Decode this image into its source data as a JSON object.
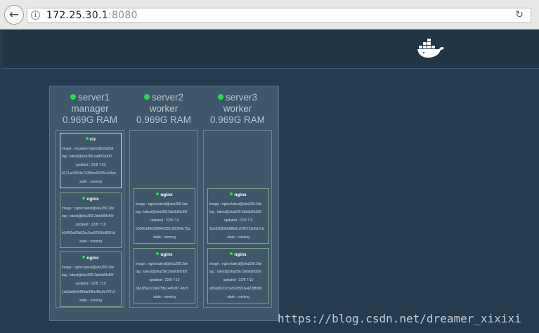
{
  "browser": {
    "url_host": "172.25.30.1",
    "url_port": ":8080"
  },
  "nodes": [
    {
      "name": "server1",
      "role": "manager",
      "ram": "0.969G RAM",
      "tasks": [
        {
          "name": "viz",
          "image": "image : visualizer:latest@sha256",
          "tag": "tag : latest@sha256:ea803c00f7",
          "updated": "updated : 22/8 7:23",
          "id": "8271ac2554e7535bed2035c1c9ee",
          "state": "state : running"
        },
        {
          "name": "nginx",
          "image": "image : nginx:latest@sha256:2de",
          "tag": "tag : latest@sha256:2de9d5fc65f",
          "updated": "updated : 22/8 7:10",
          "id": "b346f9e82b02cc6ce82366d6091d",
          "state": "state : running"
        },
        {
          "name": "nginx",
          "image": "image : nginx:latest@sha256:2de",
          "tag": "tag : latest@sha256:2de9d5fc65f",
          "updated": "updated : 22/8 7:10",
          "id": "1dd3ab0e548fda496e45c9e797c3",
          "state": "state : running"
        }
      ]
    },
    {
      "name": "server2",
      "role": "worker",
      "ram": "0.969G RAM",
      "tasks": [
        {
          "name": "nginx",
          "image": "image : nginx:latest@sha256:2de",
          "tag": "tag : latest@sha256:2de9d5fc65f",
          "updated": "updated : 22/8 7:9",
          "id": "e3506a450299642251092254c75a",
          "state": "state : running"
        },
        {
          "name": "nginx",
          "image": "image : nginx:latest@sha256:2de",
          "tag": "tag : latest@sha256:2de9d5fc65f",
          "updated": "updated : 22/8 7:10",
          "id": "68e386e2c2a67fda1445087 4bc9",
          "state": "state : running"
        }
      ]
    },
    {
      "name": "server3",
      "role": "worker",
      "ram": "0.969G RAM",
      "tasks": [
        {
          "name": "nginx",
          "image": "image : nginx:latest@sha256:2de",
          "tag": "tag : latest@sha256:2de9d5fc65f",
          "updated": "updated : 22/8 7:9",
          "id": "1be92055b668b01d78b713e6a7cb",
          "state": "state : running"
        },
        {
          "name": "nginx",
          "image": "image : nginx:latest@sha256:2de",
          "tag": "tag : latest@sha256:2de9d5fc65f",
          "updated": "updated : 22/8 7:10",
          "id": "a8f2a0631ccad02d591e4228f9d9",
          "state": "state : running"
        }
      ]
    }
  ],
  "watermark": "https://blog.csdn.net/dreamer_xixixi",
  "colors": {
    "background": "#253c4f",
    "running_dot": "#2bd94a",
    "task_border": "#7da685"
  }
}
